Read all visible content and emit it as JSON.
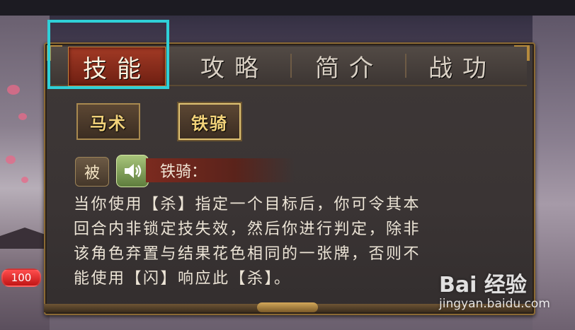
{
  "tabs": [
    {
      "label": "技能",
      "active": true
    },
    {
      "label": "攻略",
      "active": false
    },
    {
      "label": "简介",
      "active": false
    },
    {
      "label": "战功",
      "active": false
    }
  ],
  "skills": [
    {
      "label": "马术",
      "selected": false
    },
    {
      "label": "铁骑",
      "selected": true
    }
  ],
  "skill_detail": {
    "type_tag": "被",
    "sound_icon": "speaker-icon",
    "name": "铁骑：",
    "description_lines": [
      "当你使用【杀】指定一个目标后，你可令其本",
      "回合内非锁定技失效，然后你进行判定，除非",
      "该角色弃置与结果花色相同的一张牌，否则不",
      "能使用【闪】响应此【杀】。"
    ]
  },
  "side": {
    "level_badge": "100"
  },
  "watermark": {
    "brand": "Bai 经验",
    "url": "jingyan.baidu.com"
  },
  "colors": {
    "highlight": "#2fd0d8",
    "active_tab": "#a23a25",
    "skill_text": "#f2d27a"
  }
}
